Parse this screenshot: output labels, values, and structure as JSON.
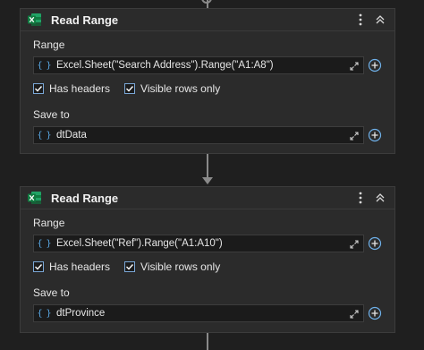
{
  "activities": [
    {
      "title": "Read Range",
      "range_label": "Range",
      "range_value": "Excel.Sheet(\"Search Address\").Range(\"A1:A8\")",
      "has_headers_label": "Has headers",
      "has_headers_checked": true,
      "visible_rows_label": "Visible rows only",
      "visible_rows_checked": true,
      "save_to_label": "Save to",
      "save_to_value": "dtData"
    },
    {
      "title": "Read Range",
      "range_label": "Range",
      "range_value": "Excel.Sheet(\"Ref\").Range(\"A1:A10\")",
      "has_headers_label": "Has headers",
      "has_headers_checked": true,
      "visible_rows_label": "Visible rows only",
      "visible_rows_checked": true,
      "save_to_label": "Save to",
      "save_to_value": "dtProvince"
    }
  ],
  "icons": {
    "activity": "excel-icon",
    "more": "more-vertical-icon",
    "collapse": "collapse-icon",
    "variable": "variable-braces-icon",
    "expand": "expand-editor-icon",
    "add": "plus-circle-icon"
  },
  "colors": {
    "background": "#1f1f1f",
    "card": "#2b2b2b",
    "accent": "#5aa9e6",
    "excel_green": "#1d7044"
  }
}
